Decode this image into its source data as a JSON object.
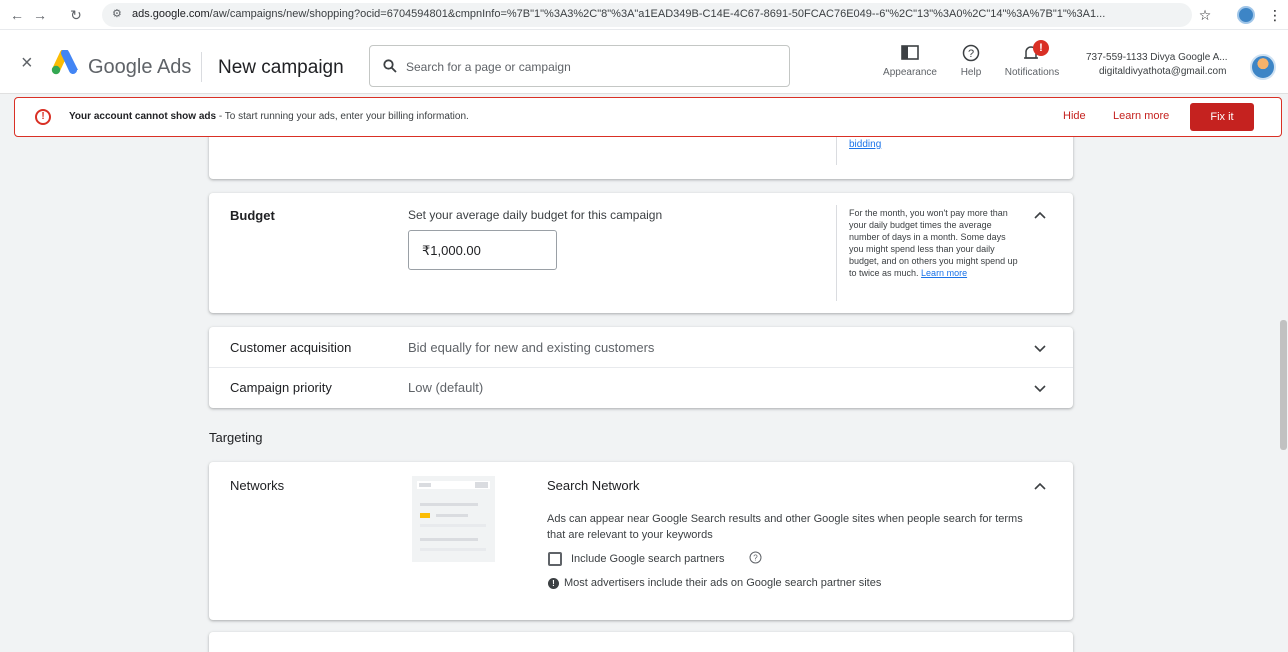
{
  "browser": {
    "url_domain": "ads.google.com",
    "url_path": "/aw/campaigns/new/shopping?ocid=6704594801&cmpnInfo=%7B\"1\"%3A3%2C\"8\"%3A\"a1EAD349B-C14E-4C67-8691-50FCAC76E049--6\"%2C\"13\"%3A0%2C\"14\"%3A%7B\"1\"%3A1..."
  },
  "header": {
    "product_name": "Google Ads",
    "page_title": "New campaign",
    "search_placeholder": "Search for a page or campaign",
    "tools": [
      {
        "label": "Appearance",
        "icon": "appearance-icon"
      },
      {
        "label": "Help",
        "icon": "help-icon"
      },
      {
        "label": "Notifications",
        "icon": "bell-icon",
        "badge": "!"
      }
    ],
    "account_name": "737-559-1133 Divya Google A...",
    "account_email": "digitaldivyathota@gmail.com"
  },
  "alert": {
    "title": "Your account cannot show ads",
    "message": " - To start running your ads, enter your billing information.",
    "hide_label": "Hide",
    "learn_more_label": "Learn more",
    "fix_label": "Fix it"
  },
  "bidding_card": {
    "link": "bidding"
  },
  "budget_card": {
    "title": "Budget",
    "instruction": "Set your average daily budget for this campaign",
    "value": "₹1,000.00",
    "note": "For the month, you won't pay more than your daily budget times the average number of days in a month. Some days you might spend less than your daily budget, and on others you might spend up to twice as much.",
    "note_link": "Learn more"
  },
  "settings_rows": [
    {
      "label": "Customer acquisition",
      "value": "Bid equally for new and existing customers"
    },
    {
      "label": "Campaign priority",
      "value": "Low (default)"
    }
  ],
  "targeting": {
    "heading": "Targeting",
    "networks_title": "Networks",
    "search_network_title": "Search Network",
    "search_network_desc": "Ads can appear near Google Search results and other Google sites when people search for terms that are relevant to your keywords",
    "partners_label": "Include Google search partners",
    "partners_checked": false,
    "partners_hint": "Most advertisers include their ads on Google search partner sites"
  },
  "colors": {
    "error": "#d93025",
    "fix_button": "#c5221f",
    "link": "#1a73e8"
  }
}
